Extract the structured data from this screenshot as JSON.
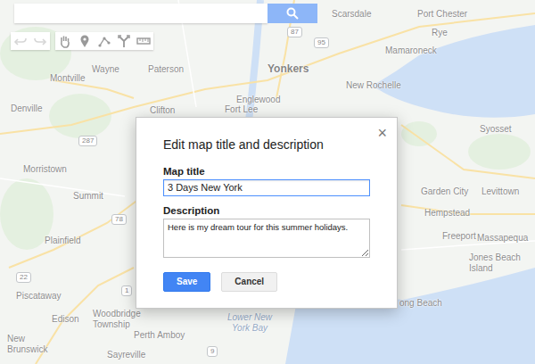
{
  "toolbar": [
    {
      "kind": "undo",
      "disabled": true
    },
    {
      "kind": "redo",
      "disabled": true
    },
    {
      "kind": "hand",
      "disabled": false
    },
    {
      "kind": "marker",
      "disabled": false
    },
    {
      "kind": "line",
      "disabled": false
    },
    {
      "kind": "route",
      "disabled": false
    },
    {
      "kind": "ruler",
      "disabled": false
    }
  ],
  "map": {
    "labels": [
      {
        "text": "Scarsdale",
        "kind": "city"
      },
      {
        "text": "Port Chester",
        "kind": "city"
      },
      {
        "text": "Rye",
        "kind": "city"
      },
      {
        "text": "Mamaroneck",
        "kind": "city"
      },
      {
        "text": "Yonkers",
        "kind": "major"
      },
      {
        "text": "New Rochelle",
        "kind": "city"
      },
      {
        "text": "Wayne",
        "kind": "city"
      },
      {
        "text": "Paterson",
        "kind": "city"
      },
      {
        "text": "Montville",
        "kind": "city"
      },
      {
        "text": "Denville",
        "kind": "city"
      },
      {
        "text": "Englewood",
        "kind": "city"
      },
      {
        "text": "Clifton",
        "kind": "city"
      },
      {
        "text": "Fort Lee",
        "kind": "city"
      },
      {
        "text": "Syosset",
        "kind": "city"
      },
      {
        "text": "Morristown",
        "kind": "city"
      },
      {
        "text": "Summit",
        "kind": "city"
      },
      {
        "text": "Garden City",
        "kind": "city"
      },
      {
        "text": "Levittown",
        "kind": "city"
      },
      {
        "text": "Hempstead",
        "kind": "city"
      },
      {
        "text": "Freeport",
        "kind": "city"
      },
      {
        "text": "Massapequa",
        "kind": "city"
      },
      {
        "text": "Plainfield",
        "kind": "city"
      },
      {
        "text": "Jones Beach Island",
        "kind": "city"
      },
      {
        "text": "ong Beach",
        "kind": "city"
      },
      {
        "text": "Piscataway",
        "kind": "city"
      },
      {
        "text": "Edison",
        "kind": "city"
      },
      {
        "text": "Woodbridge Township",
        "kind": "city"
      },
      {
        "text": "Perth Amboy",
        "kind": "city"
      },
      {
        "text": "New Brunswick",
        "kind": "city"
      },
      {
        "text": "Sayreville",
        "kind": "city"
      },
      {
        "text": "Lower New York Bay",
        "kind": "water"
      },
      {
        "text": "87",
        "kind": "road"
      },
      {
        "text": "287",
        "kind": "road"
      },
      {
        "text": "95",
        "kind": "road"
      },
      {
        "text": "22",
        "kind": "road"
      },
      {
        "text": "78",
        "kind": "road"
      },
      {
        "text": "1",
        "kind": "road"
      },
      {
        "text": "9",
        "kind": "road"
      }
    ]
  },
  "dialog": {
    "title": "Edit map title and description",
    "close": "×",
    "fields": [
      {
        "label": "Map title",
        "value": "3 Days New York",
        "kind": "input",
        "focused": true
      },
      {
        "label": "Description",
        "value": "Here is my dream tour for this summer holidays.",
        "kind": "textarea",
        "focused": false
      }
    ],
    "buttons": [
      {
        "label": "Save",
        "primary": true
      },
      {
        "label": "Cancel",
        "primary": false
      }
    ]
  }
}
